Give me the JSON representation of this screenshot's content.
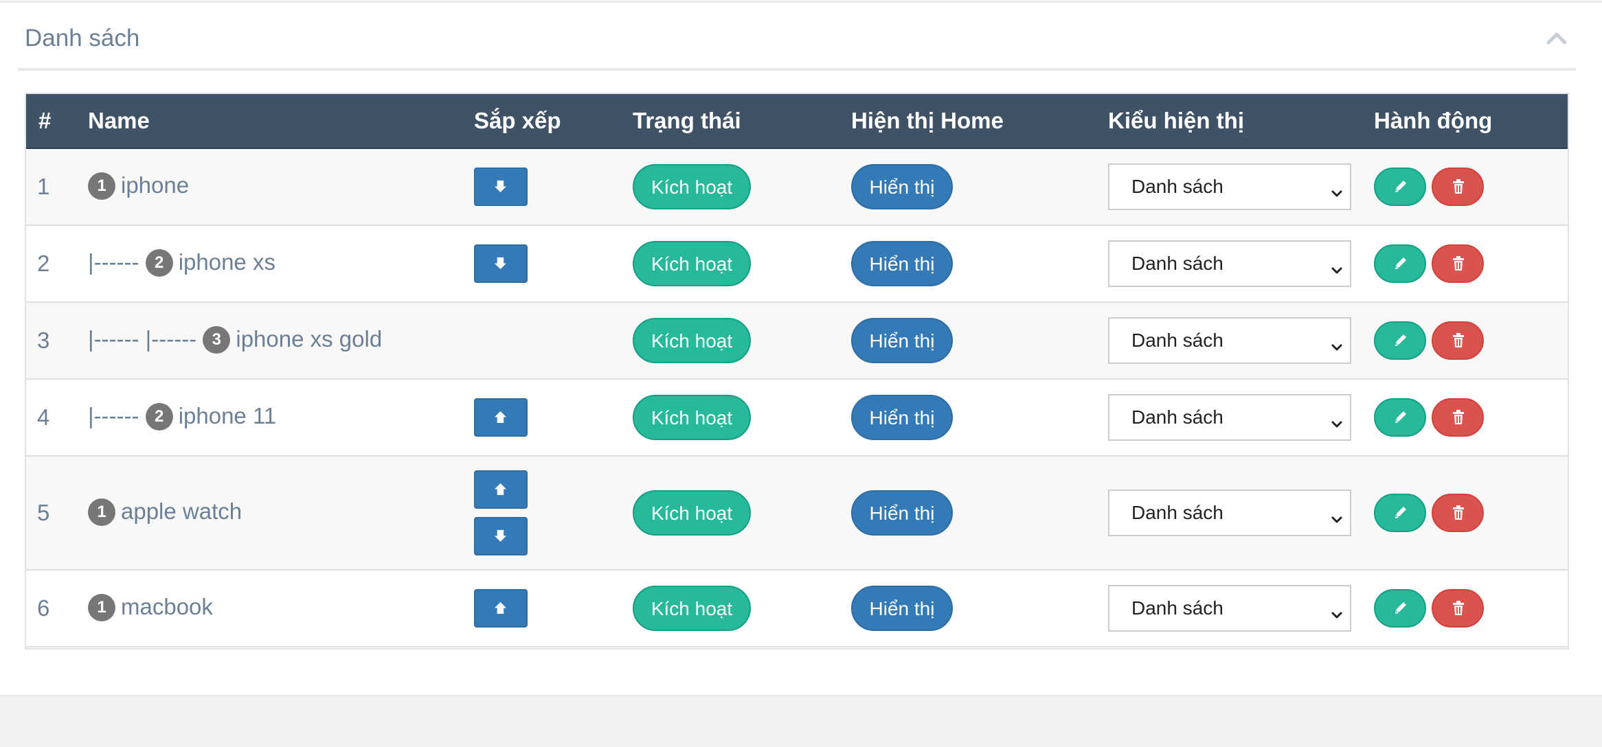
{
  "panel": {
    "title": "Danh sách",
    "collapse_icon": "chevron-up-icon"
  },
  "table": {
    "headers": [
      "#",
      "Name",
      "Sắp xếp",
      "Trạng thái",
      "Hiện thị Home",
      "Kiểu hiện thị",
      "Hành động"
    ],
    "rows": [
      {
        "index": "1",
        "indent": "",
        "level": "1",
        "name": "iphone",
        "sort": [
          "down"
        ],
        "status": "Kích hoạt",
        "home": "Hiển thị",
        "display_type": "Danh sách"
      },
      {
        "index": "2",
        "indent": "|------ ",
        "level": "2",
        "name": "iphone xs",
        "sort": [
          "down"
        ],
        "status": "Kích hoạt",
        "home": "Hiển thị",
        "display_type": "Danh sách"
      },
      {
        "index": "3",
        "indent": "|------ |------ ",
        "level": "3",
        "name": "iphone xs gold",
        "sort": [],
        "status": "Kích hoạt",
        "home": "Hiển thị",
        "display_type": "Danh sách"
      },
      {
        "index": "4",
        "indent": "|------ ",
        "level": "2",
        "name": "iphone 11",
        "sort": [
          "up"
        ],
        "status": "Kích hoạt",
        "home": "Hiển thị",
        "display_type": "Danh sách"
      },
      {
        "index": "5",
        "indent": "",
        "level": "1",
        "name": "apple watch",
        "sort": [
          "up",
          "down"
        ],
        "status": "Kích hoạt",
        "home": "Hiển thị",
        "display_type": "Danh sách"
      },
      {
        "index": "6",
        "indent": "",
        "level": "1",
        "name": "macbook",
        "sort": [
          "up"
        ],
        "status": "Kích hoạt",
        "home": "Hiển thị",
        "display_type": "Danh sách"
      }
    ]
  },
  "colors": {
    "header_bg": "#405366",
    "success": "#26b99a",
    "primary": "#337ab7",
    "danger": "#d9534f",
    "badge": "#777777"
  },
  "icons": {
    "sort_up": "arrow-up-icon",
    "sort_down": "arrow-down-icon",
    "edit": "pencil-icon",
    "delete": "trash-icon",
    "select": "chevron-down-icon"
  }
}
